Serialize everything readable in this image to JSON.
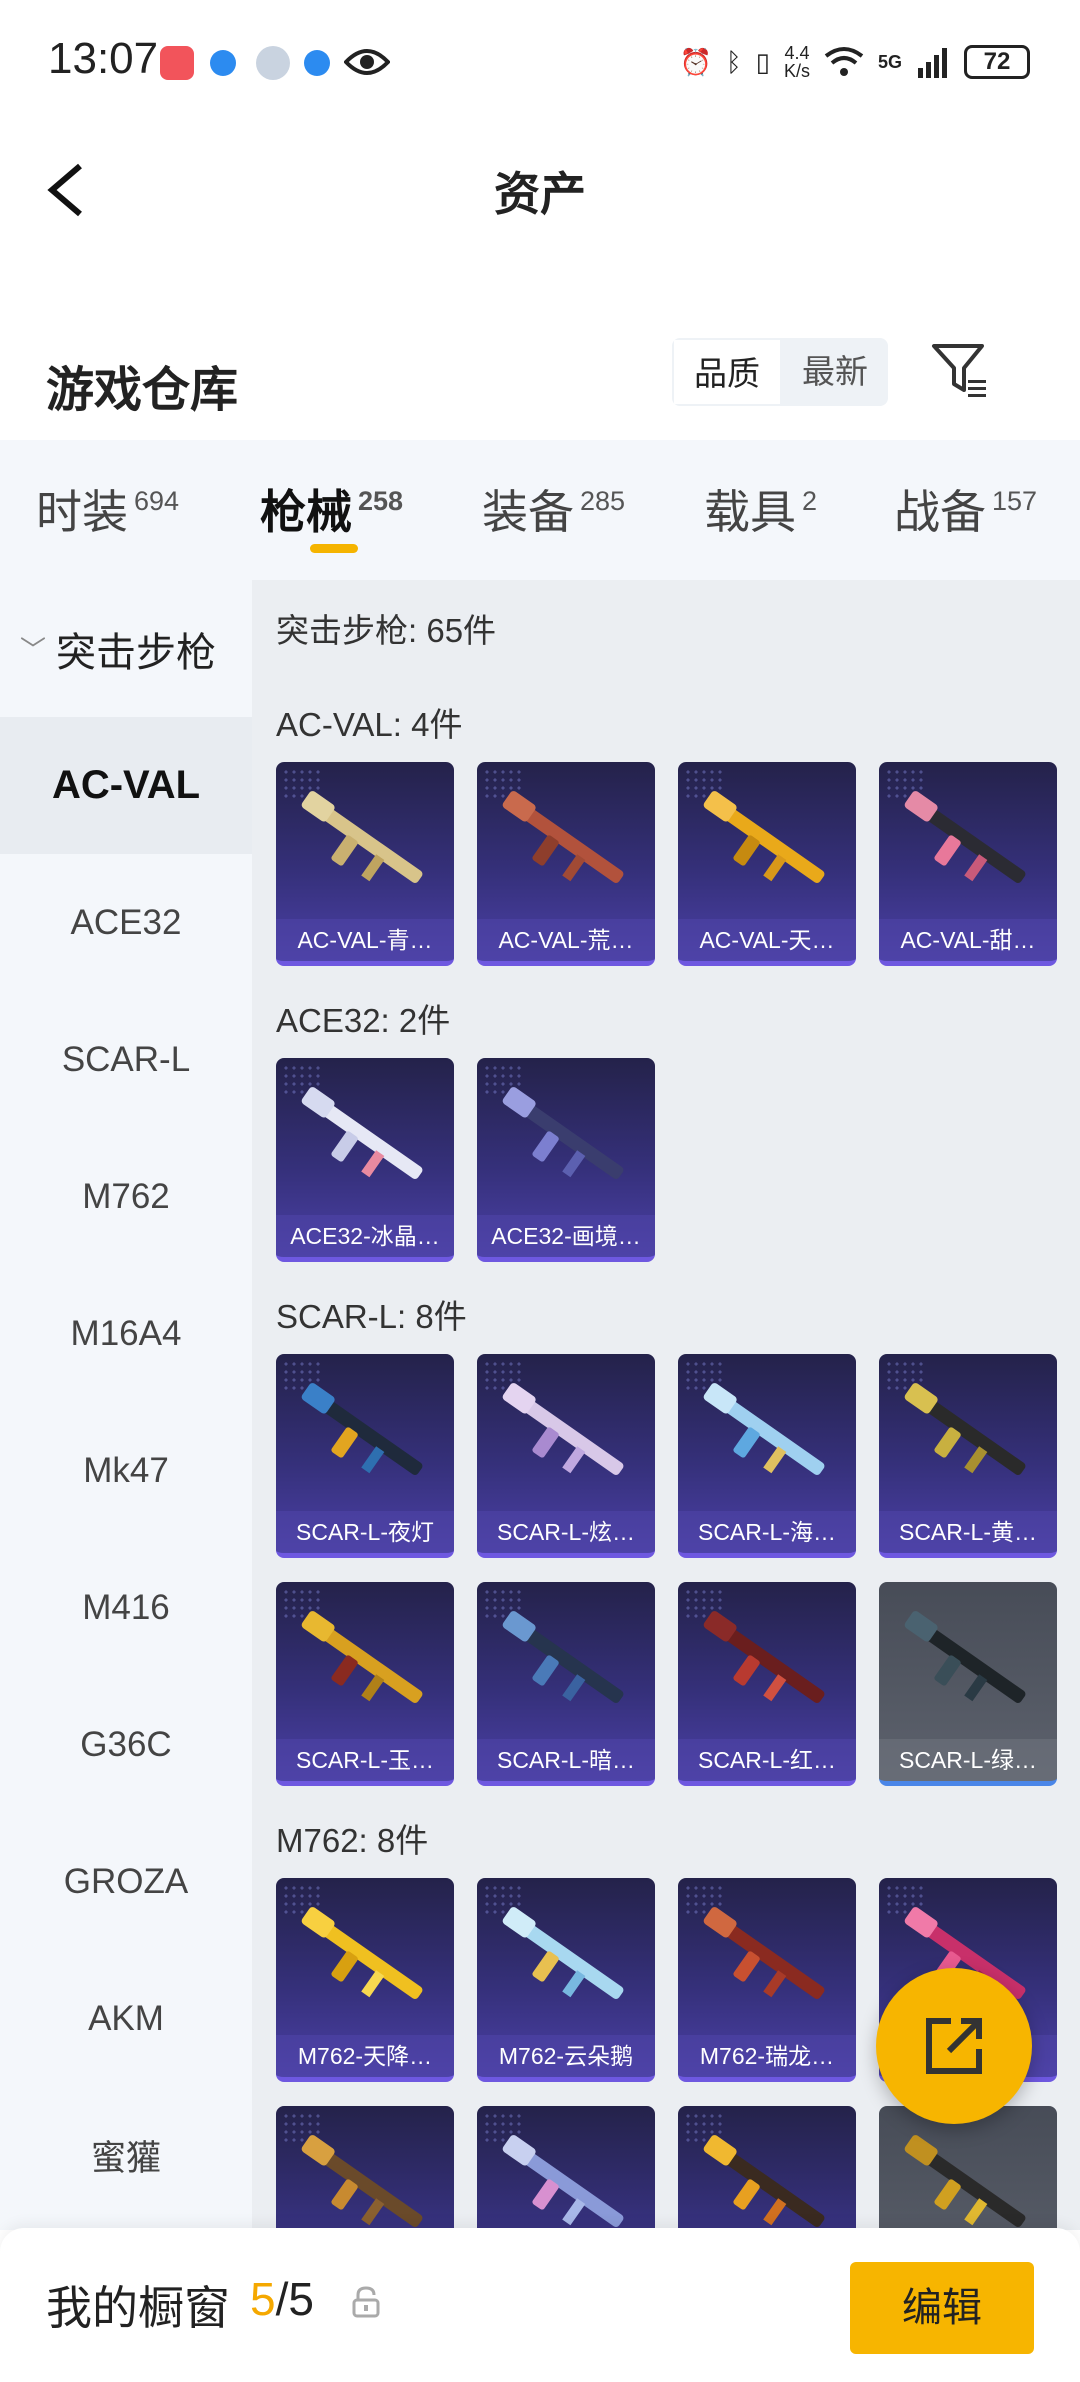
{
  "status_bar": {
    "time": "13:07",
    "net_speed_value": "4.4",
    "net_speed_unit": "K/s",
    "network_type": "5G",
    "battery": "72"
  },
  "header": {
    "title": "资产"
  },
  "warehouse": {
    "title": "游戏仓库",
    "sort_options": [
      "品质",
      "最新"
    ],
    "active_sort": "品质"
  },
  "tabs": [
    {
      "label": "时装",
      "count": "694"
    },
    {
      "label": "枪械",
      "count": "258",
      "active": true
    },
    {
      "label": "装备",
      "count": "285"
    },
    {
      "label": "载具",
      "count": "2"
    },
    {
      "label": "战备",
      "count": "157"
    }
  ],
  "sidebar": {
    "group_label": "突击步枪",
    "items": [
      "AC-VAL",
      "ACE32",
      "SCAR-L",
      "M762",
      "M16A4",
      "Mk47",
      "M416",
      "G36C",
      "GROZA",
      "AKM",
      "蜜獾"
    ],
    "active": "AC-VAL"
  },
  "content": {
    "summary": "突击步枪: 65件",
    "sections": [
      {
        "title": "AC-VAL: 4件",
        "items": [
          "AC-VAL-青…",
          "AC-VAL-荒…",
          "AC-VAL-天…",
          "AC-VAL-甜…"
        ]
      },
      {
        "title": "ACE32: 2件",
        "items": [
          "ACE32-冰晶…",
          "ACE32-画境…"
        ]
      },
      {
        "title": "SCAR-L: 8件",
        "items": [
          "SCAR-L-夜灯",
          "SCAR-L-炫…",
          "SCAR-L-海…",
          "SCAR-L-黄…",
          "SCAR-L-玉…",
          "SCAR-L-暗…",
          "SCAR-L-红…",
          "SCAR-L-绿…"
        ]
      },
      {
        "title": "M762: 8件",
        "items": [
          "M762-天降…",
          "M762-云朵鹅",
          "M762-瑞龙…",
          ""
        ]
      }
    ]
  },
  "bottom_bar": {
    "label": "我的橱窗",
    "current": "5",
    "total": "/5",
    "edit_label": "编辑"
  },
  "colors": {
    "accent": "#f7b500",
    "card_purple": "#35307a",
    "page_bg": "#f4f7fb"
  }
}
